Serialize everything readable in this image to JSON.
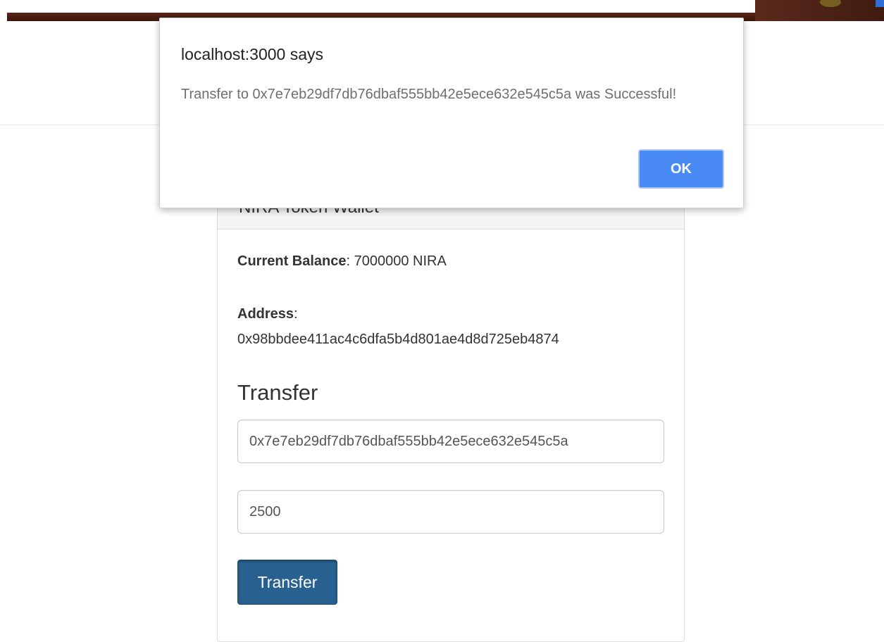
{
  "dialog": {
    "title": "localhost:3000 says",
    "message": "Transfer to 0x7e7eb29df7db76dbaf555bb42e5ece632e545c5a was Successful!",
    "ok_label": "OK"
  },
  "wallet": {
    "heading": "NIRA Token Wallet",
    "balance_label": "Current Balance",
    "balance_value": "7000000 NIRA",
    "address_label": "Address",
    "address_value": "0x98bbdee411ac4c6dfa5b4d801ae4d8d725eb4874",
    "transfer_title": "Transfer",
    "recipient_value": "0x7e7eb29df7db76dbaf555bb42e5ece632e545c5a",
    "amount_value": "2500",
    "transfer_button_label": "Transfer"
  },
  "colors": {
    "primary_button": "#286090",
    "dialog_ok_button": "#4a8af4",
    "panel_heading_bg": "#f5f5f5"
  }
}
